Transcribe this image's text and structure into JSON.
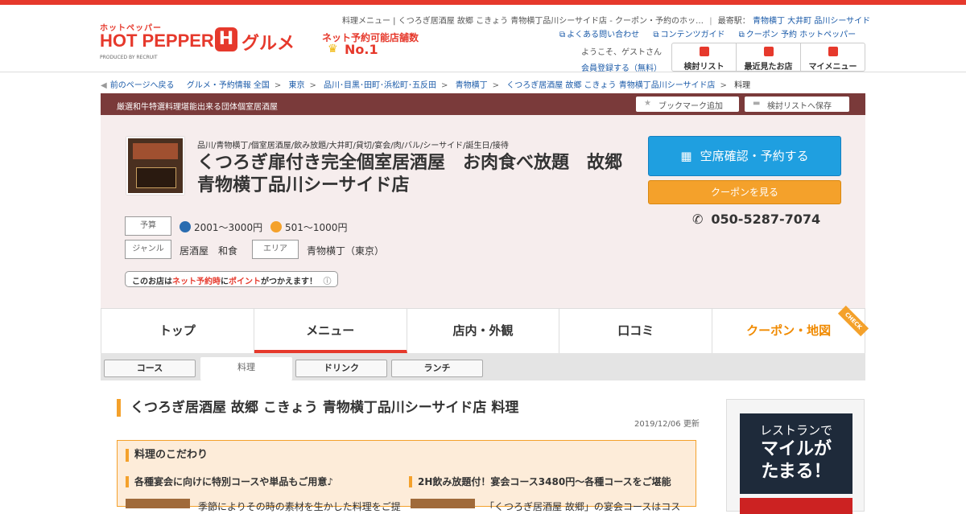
{
  "header": {
    "logo_small": "ホットペッパー",
    "logo_big": "HOT PEPPER",
    "logo_h": "H",
    "logo_gurume": "グルメ",
    "logo_produced": "PRODUCED BY RECRUIT",
    "badge_line1": "ネット予約可能店舗数",
    "badge_line2": "No.1",
    "page_title_crumb": "料理メニュー | くつろぎ居酒屋 故郷 こきょう 青物横丁品川シーサイド店 - クーポン・予約のホッ…",
    "station_label": "最寄駅：",
    "station_links": [
      "青物横丁",
      "大井町",
      "品川シーサイド"
    ],
    "links": [
      "よくある問い合わせ",
      "コンテンツガイド",
      "クーポン 予約 ホットペッパー"
    ],
    "welcome": "ようこそ、ゲストさん",
    "register": "会員登録する（無料）",
    "buttons": [
      "検討リスト",
      "最近見たお店",
      "マイメニュー"
    ]
  },
  "breadcrumb": {
    "back": "前のページへ戻る",
    "items": [
      "グルメ・予約情報 全国",
      "東京",
      "品川･目黒･田町･浜松町･五反田",
      "青物横丁",
      "くつろぎ居酒屋 故郷 こきょう 青物横丁品川シーサイド店"
    ],
    "current": "料理"
  },
  "shop": {
    "catch": "厳選和牛特選料理堪能出来る団体個室居酒屋",
    "bookmark": "ブックマーク追加",
    "savelist": "検討リストへ保存",
    "tags": "品川/青物横丁/個室居酒屋/飲み放題/大井町/貸切/宴会/肉/バル/シーサイド/誕生日/接待",
    "name": "くつろぎ扉付き完全個室居酒屋　お肉食べ放題　故郷　青物横丁品川シーサイド店",
    "reserve_btn": "空席確認・予約する",
    "coupon_btn": "クーポンを見る",
    "phone": "050-5287-7074",
    "budget_label": "予算",
    "budget_dinner": "2001～3000円",
    "budget_lunch": "501～1000円",
    "genre_label": "ジャンル",
    "genre": "居酒屋　和食",
    "area_label": "エリア",
    "area": "青物横丁（東京）",
    "point_pre": "このお店は",
    "point_red1": "ネット予約時",
    "point_mid": "に",
    "point_red2": "ポイント",
    "point_post": "がつかえます！"
  },
  "tabs": [
    "トップ",
    "メニュー",
    "店内・外観",
    "口コミ",
    "クーポン・地図"
  ],
  "tab_check": "CHECK",
  "subtabs": [
    "コース",
    "料理",
    "ドリンク",
    "ランチ"
  ],
  "content": {
    "title": "くつろぎ居酒屋 故郷 こきょう 青物横丁品川シーサイド店 料理",
    "updated": "2019/12/06 更新",
    "kodawari_title": "料理のこだわり",
    "sub1": "各種宴会に向けに特別コースや単品もご用意♪",
    "sub2": "2H飲み放題付！宴会コース3480円～各種コースをご堪能",
    "text1": "季節によりその時の素材を生かした料理をご提",
    "text2": "「くつろぎ居酒屋 故郷」の宴会コースはコス"
  },
  "ad": {
    "line1": "レストランで",
    "line2": "マイルが",
    "line3": "たまる！"
  }
}
